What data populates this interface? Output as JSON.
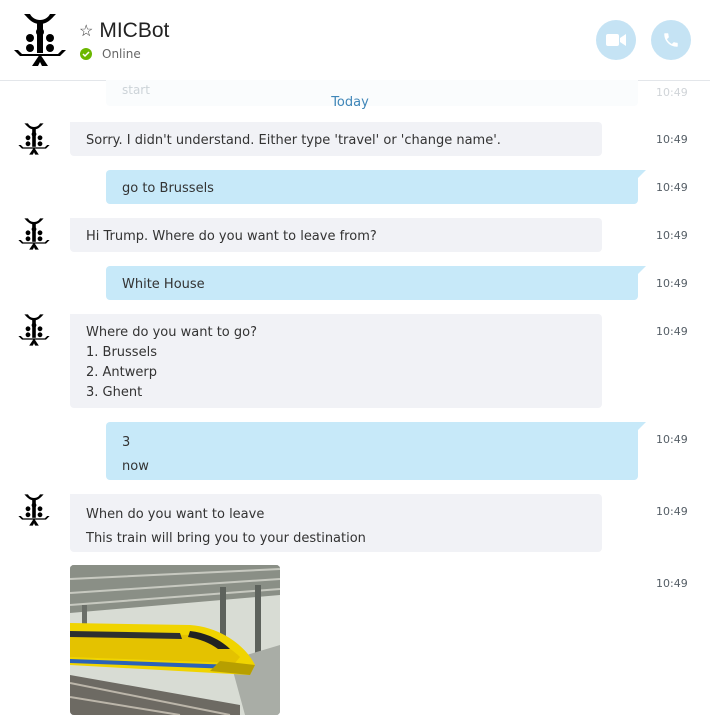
{
  "header": {
    "title": "MICBot",
    "status": "Online",
    "colors": {
      "online": "#6bb700",
      "action_button": "#c5e3f4"
    },
    "icons": [
      "star-icon",
      "video-call-icon",
      "audio-call-icon",
      "online-check-icon"
    ]
  },
  "chat": {
    "ghost_text": "start",
    "ghost_time": "10:49",
    "date_divider": "Today",
    "messages": [
      {
        "from": "bot",
        "lines": [
          "Sorry. I didn't understand. Either type 'travel' or 'change name'."
        ],
        "time": "10:49"
      },
      {
        "from": "me",
        "lines": [
          "go to Brussels"
        ],
        "time": "10:49"
      },
      {
        "from": "bot",
        "lines": [
          "Hi Trump. Where do you want to leave from?"
        ],
        "time": "10:49"
      },
      {
        "from": "me",
        "lines": [
          "White House"
        ],
        "time": "10:49"
      },
      {
        "from": "bot",
        "lines": [
          "Where do you want to go?",
          "1. Brussels",
          "2. Antwerp",
          "3. Ghent"
        ],
        "time": "10:49"
      },
      {
        "from": "me",
        "lines": [
          "3",
          "now"
        ],
        "time": "10:49"
      },
      {
        "from": "bot",
        "lines": [
          "When do you want to leave",
          "This train will bring you to your destination"
        ],
        "time": "10:49"
      },
      {
        "from": "bot",
        "image": "yellow-bullet-train-photo",
        "time": "10:49"
      }
    ]
  }
}
